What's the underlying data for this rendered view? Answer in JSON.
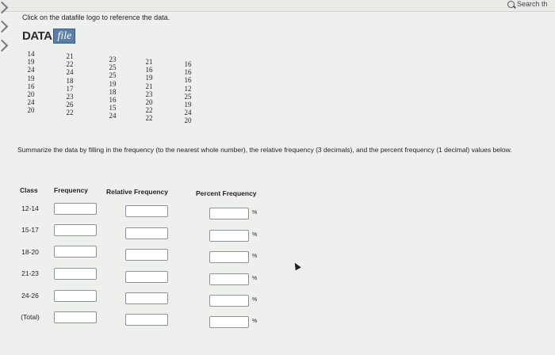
{
  "topbar": {
    "search_text": "Search th"
  },
  "instruction": "Click on the datafile logo to reference the data.",
  "logo": {
    "word": "DATA",
    "badge": "file"
  },
  "data_columns": [
    [
      "14",
      "19",
      "24",
      "19",
      "16",
      "20",
      "24",
      "20"
    ],
    [
      "21",
      "22",
      "24",
      "18",
      "17",
      "23",
      "26",
      "22"
    ],
    [
      "23",
      "25",
      "25",
      "19",
      "18",
      "16",
      "15",
      "24"
    ],
    [
      "21",
      "16",
      "19",
      "21",
      "23",
      "20",
      "22",
      "22"
    ],
    [
      "16",
      "16",
      "16",
      "12",
      "25",
      "19",
      "24",
      "20"
    ]
  ],
  "prompt": "Summarize the data by filling in the frequency (to the nearest whole number), the relative frequency (3 decimals), and the percent frequency (1 decimal) values below.",
  "table": {
    "headers": [
      "Class",
      "Frequency",
      "Relative Frequency",
      "Percent Frequency"
    ],
    "rows": [
      {
        "class": "12-14",
        "frequency": "",
        "relative": "",
        "percent": ""
      },
      {
        "class": "15-17",
        "frequency": "",
        "relative": "",
        "percent": ""
      },
      {
        "class": "18-20",
        "frequency": "",
        "relative": "",
        "percent": ""
      },
      {
        "class": "21-23",
        "frequency": "",
        "relative": "",
        "percent": ""
      },
      {
        "class": "24-26",
        "frequency": "",
        "relative": "",
        "percent": ""
      },
      {
        "class": "(Total)",
        "frequency": "",
        "relative": "",
        "percent": ""
      }
    ],
    "percent_sign": "%"
  }
}
